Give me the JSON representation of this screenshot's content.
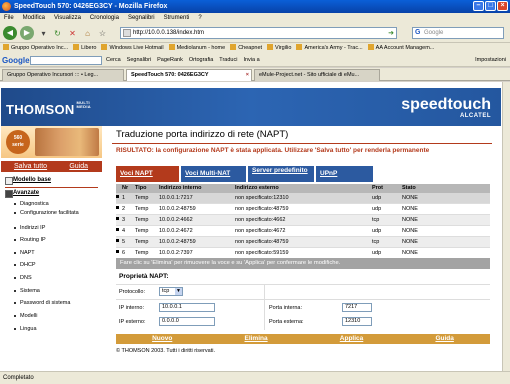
{
  "window": {
    "title": "SpeedTouch 570:  0426EG3CY - Mozilla Firefox"
  },
  "menu": [
    "File",
    "Modifica",
    "Visualizza",
    "Cronologia",
    "Segnalibri",
    "Strumenti",
    "?"
  ],
  "nav": {
    "url": "http://10.0.0.138/index.htm",
    "search_placeholder": "Google"
  },
  "bookmarks": [
    "Gruppo Operativo Inc...",
    "Libero",
    "Windows Live Hotmail",
    "Mediolanum - home",
    "Cheapnet",
    "Virgilio",
    "America's Army - Trac...",
    "AA Account Managem..."
  ],
  "googlebar": {
    "logo": "Google",
    "items": [
      "Cerca",
      "Segnalibri",
      "PageRank",
      "Ortografia",
      "Traduci",
      "Invia a"
    ],
    "settings": "Impostazioni"
  },
  "tabs": [
    {
      "label": "Gruppo Operativo Incursori ::: • Leg..."
    },
    {
      "label": "SpeedTouch 570:  0426EG3CY"
    },
    {
      "label": "eMule-Project.net - Sito ufficiale di eMu..."
    }
  ],
  "header": {
    "brand": "THOMSON",
    "brand_sub": "MULTI MEDIA",
    "product": "speedtouch",
    "maker": "ALCATEL"
  },
  "sidebar": {
    "badge": {
      "line1": "560",
      "line2": "serie"
    },
    "save": "Salva tutto",
    "guide": "Guida",
    "basic": "Modello base",
    "advanced": "Avanzate",
    "items": [
      "Diagnostica",
      "Configurazione facilitata",
      "Indirizzi IP",
      "Routing IP",
      "NAPT",
      "DHCP",
      "DNS",
      "Sistema",
      "Password di sistema",
      "Modelli",
      "Lingua"
    ]
  },
  "page": {
    "title": "Traduzione porta indirizzo di rete (NAPT)",
    "result": "RISULTATO: la configurazione NAPT è stata applicata. Utilizzare 'Salva tutto' per renderla permanente",
    "content_tabs": [
      "Voci NAPT",
      "Voci Multi-NAT",
      "Server predefinito",
      "UPnP"
    ],
    "table": {
      "headers": [
        "Nr",
        "Tipo",
        "Indirizzo interno",
        "Indirizzo esterno",
        "Prot",
        "Stato"
      ],
      "rows": [
        [
          "1",
          "Temp",
          "10.0.0.1:7217",
          "non specificato:12310",
          "udp",
          "NONE"
        ],
        [
          "2",
          "Temp",
          "10.0.0.2:48759",
          "non specificato:48759",
          "udp",
          "NONE"
        ],
        [
          "3",
          "Temp",
          "10.0.0.2:4662",
          "non specificato:4662",
          "tcp",
          "NONE"
        ],
        [
          "4",
          "Temp",
          "10.0.0.2:4672",
          "non specificato:4672",
          "udp",
          "NONE"
        ],
        [
          "5",
          "Temp",
          "10.0.0.2:48759",
          "non specificato:48759",
          "tcp",
          "NONE"
        ],
        [
          "6",
          "Temp",
          "10.0.0.2:7397",
          "non specificato:59159",
          "udp",
          "NONE"
        ]
      ]
    },
    "hint": "Fare clic su 'Elimina' per rimuovere la voce e su 'Applica' per confermare le modifiche.",
    "props": {
      "title": "Proprietà NAPT:",
      "protocol_label": "Protocollo:",
      "protocol_value": "tcp",
      "ip_int_label": "IP interno:",
      "ip_int_value": "10.0.0.1",
      "ip_ext_label": "IP esterno:",
      "ip_ext_value": "0.0.0.0",
      "port_int_label": "Porta interna:",
      "port_int_value": "7217",
      "port_ext_label": "Porta esterna:",
      "port_ext_value": "12310"
    },
    "actions": [
      "Nuovo",
      "Elimina",
      "Applica",
      "Guida"
    ],
    "footer": "© THOMSON 2003. Tutti i diritti riservati."
  },
  "status": "Completato"
}
